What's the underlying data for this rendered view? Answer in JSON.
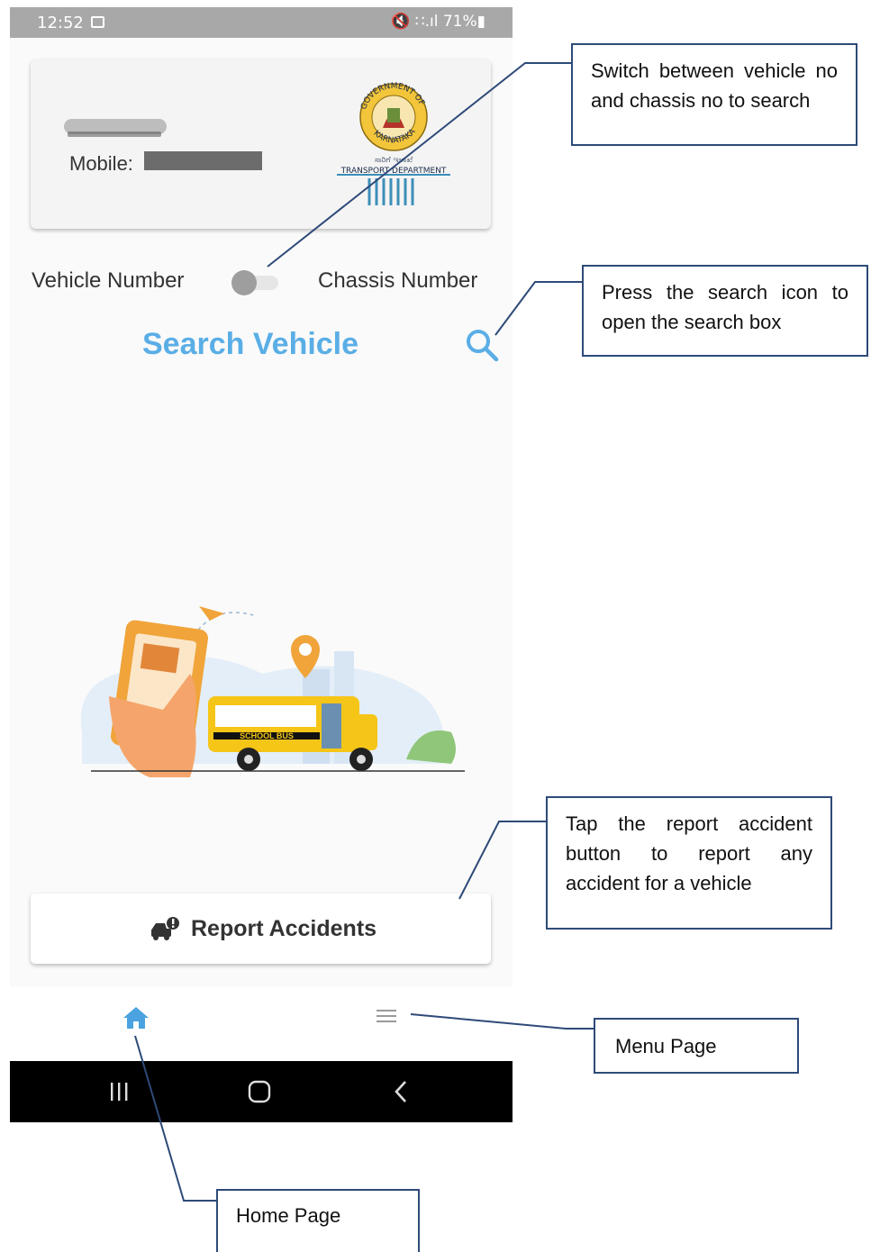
{
  "status_bar": {
    "time": "12:52",
    "right": "🔇 ∷.ıl 71%▮"
  },
  "profile": {
    "mobile_label": "Mobile:"
  },
  "logo": {
    "top_text": "GOVERNMENT OF",
    "bottom_text": "KARNATAKA",
    "kannada": "ಸಾರಿಗೆ ಇಲಾಖೆ",
    "dept": "TRANSPORT DEPARTMENT"
  },
  "toggle": {
    "left_label": "Vehicle Number",
    "right_label": "Chassis Number"
  },
  "search": {
    "title": "Search Vehicle"
  },
  "illustration": {
    "bus_text": "SCHOOL BUS"
  },
  "report_button": {
    "label": "Report Accidents"
  },
  "callouts": {
    "toggle": "Switch between vehicle no and chassis no to search",
    "search": "Press the search icon to open the search box",
    "report": "Tap the report accident button to report any accident for a vehicle",
    "menu": "Menu Page",
    "home": "Home Page"
  },
  "colors": {
    "accent": "#5aaee6",
    "callout_border": "#2e4a78",
    "status_bar": "#a8a8a8"
  }
}
